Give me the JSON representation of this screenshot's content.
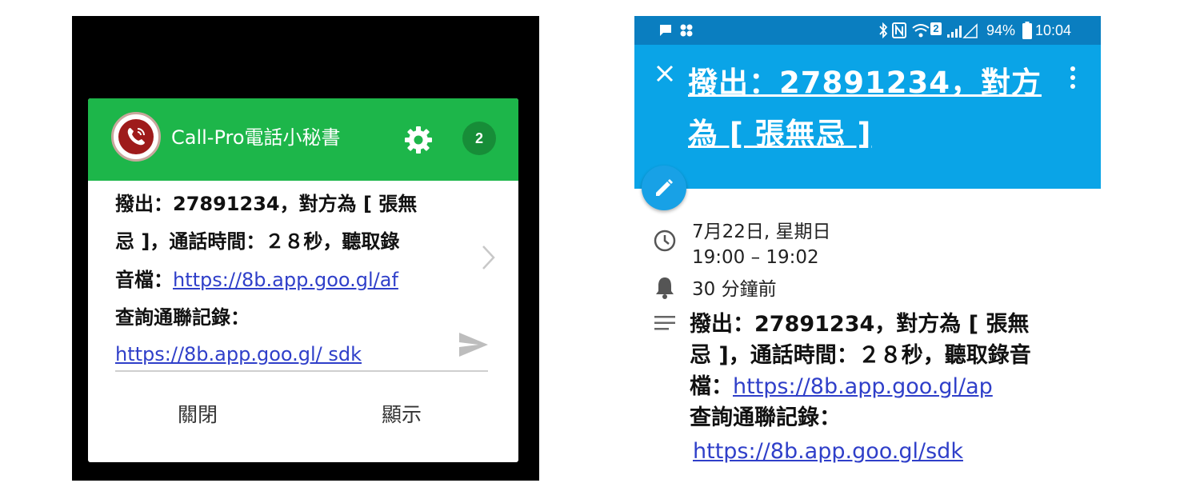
{
  "left": {
    "app_title": "Call-Pro電話小秘書",
    "badge_count": "2",
    "message_lines": [
      "撥出：27891234，對方為 [ 張無",
      "忌 ]，通話時間：２８秒，聽取錄"
    ],
    "line3_prefix": "音檔：",
    "line3_link": "https://8b.app.goo.gl/af",
    "line4": "查詢通聯記錄：",
    "line5_link": "https://8b.app.goo.gl/ sdk",
    "close_label": "關閉",
    "show_label": "顯示",
    "header_color": "#1db64a"
  },
  "right": {
    "status": {
      "battery": "94%",
      "time": "10:04",
      "sim_badge": "2"
    },
    "event_title_line1": "撥出：27891234，對方",
    "event_title_line2": "為 [ 張無忌 ]",
    "date": "7月22日, 星期日",
    "time_range": "19:00 – 19:02",
    "reminder": "30 分鐘前",
    "desc_lines": [
      "撥出：27891234，對方為 [ 張無",
      "忌 ]，通話時間：２８秒，聽取錄音"
    ],
    "desc_line3_prefix": "檔：",
    "desc_line3_link": "https://8b.app.goo.gl/ap",
    "desc_line4": "查詢通聯記錄：",
    "desc_line5_link": "https://8b.app.goo.gl/sdk",
    "appbar_color": "#0aa4e7"
  }
}
